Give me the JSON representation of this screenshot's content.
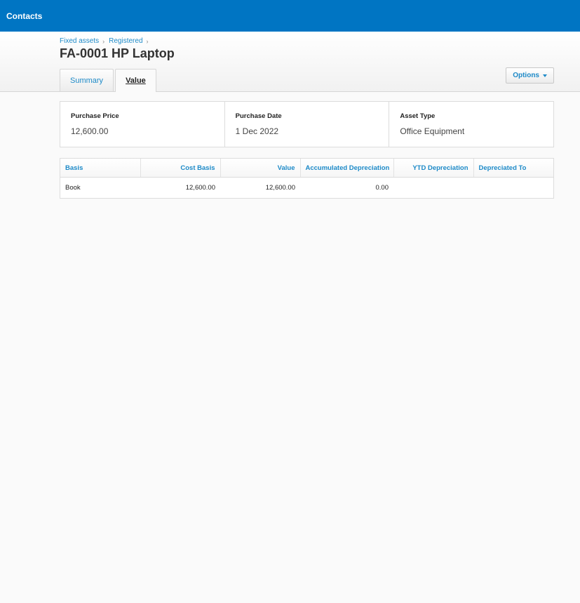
{
  "topbar": {
    "nav_label": "Contacts"
  },
  "breadcrumb": {
    "items": [
      "Fixed assets",
      "Registered"
    ],
    "separator": "›"
  },
  "page": {
    "title": "FA-0001 HP Laptop"
  },
  "tabs": [
    {
      "label": "Summary",
      "active": false
    },
    {
      "label": "Value",
      "active": true
    }
  ],
  "options_button": {
    "label": "Options",
    "icon": "caret-down-icon"
  },
  "summary": [
    {
      "label": "Purchase Price",
      "value": "12,600.00"
    },
    {
      "label": "Purchase Date",
      "value": "1 Dec 2022"
    },
    {
      "label": "Asset Type",
      "value": "Office Equipment"
    }
  ],
  "value_table": {
    "columns": [
      "Basis",
      "Cost Basis",
      "Value",
      "Accumulated Depreciation",
      "YTD Depreciation",
      "Depreciated To"
    ],
    "rows": [
      [
        "Book",
        "12,600.00",
        "12,600.00",
        "0.00",
        "",
        ""
      ]
    ]
  },
  "colors": {
    "topbar": "#0075c3",
    "link": "#1d8ac8"
  }
}
